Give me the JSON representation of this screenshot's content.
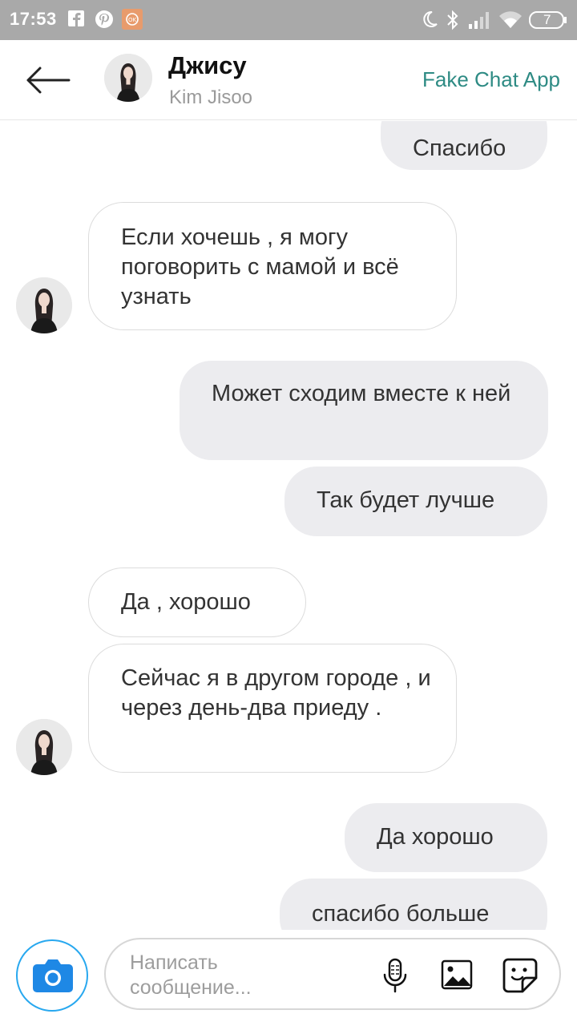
{
  "status_bar": {
    "time": "17:53",
    "battery": "7",
    "icons": [
      "facebook-icon",
      "pinterest-icon",
      "app-notification-icon",
      "moon-icon",
      "bluetooth-icon",
      "signal-icon",
      "wifi-icon",
      "battery-icon"
    ]
  },
  "header": {
    "contact_name": "Джису",
    "contact_subtitle": "Kim Jisoo",
    "app_label": "Fake Chat App"
  },
  "messages": [
    {
      "side": "out",
      "text": "Спасибо"
    },
    {
      "side": "in",
      "text": "Если хочешь , я могу поговорить с мамой и всё узнать"
    },
    {
      "side": "out",
      "text": "Может сходим вместе к ней"
    },
    {
      "side": "out",
      "text": "Так будет лучше"
    },
    {
      "side": "in",
      "text": "Да , хорошо"
    },
    {
      "side": "in",
      "text": "Сейчас я в другом городе , и через день-два приеду ."
    },
    {
      "side": "out",
      "text": "Да хорошо"
    },
    {
      "side": "out",
      "text": "спасибо больше"
    }
  ],
  "composer": {
    "placeholder": "Написать сообщение...",
    "icons": [
      "camera-icon",
      "microphone-icon",
      "image-icon",
      "sticker-icon"
    ]
  },
  "colors": {
    "status_bar": "#a9a9a9",
    "accent_teal": "#2e8b84",
    "outgoing_bubble": "#ececef",
    "camera_blue": "#1e88e5"
  }
}
